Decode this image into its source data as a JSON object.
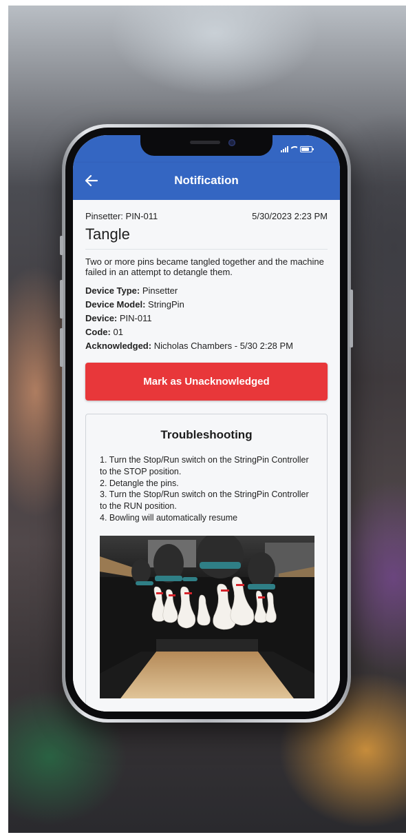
{
  "app_bar": {
    "title": "Notification",
    "back_icon": "arrow-left-icon"
  },
  "status_bar": {
    "icons": [
      "signal-icon",
      "wifi-icon",
      "battery-icon"
    ]
  },
  "notification": {
    "pinsetter": "Pinsetter: PIN-011",
    "timestamp": "5/30/2023 2:23 PM",
    "title": "Tangle",
    "description": "Two or more pins became tangled together and the machine failed in an attempt to detangle them.",
    "details": [
      {
        "label": "Device Type:",
        "value": "Pinsetter"
      },
      {
        "label": "Device Model:",
        "value": "StringPin"
      },
      {
        "label": "Device:",
        "value": "PIN-011"
      },
      {
        "label": "Code:",
        "value": "01"
      },
      {
        "label": "Acknowledged:",
        "value": "Nicholas Chambers - 5/30 2:28 PM"
      }
    ]
  },
  "actions": {
    "mark_unacknowledged": "Mark as Unacknowledged"
  },
  "troubleshooting": {
    "title": "Troubleshooting",
    "steps": [
      "1. Turn the Stop/Run switch on the StringPin Controller to the STOP position.",
      "2. Detangle the pins.",
      "3. Turn the Stop/Run switch on the StringPin Controller to the RUN position.",
      "4. Bowling will automatically resume"
    ],
    "image": "bowling-pins-tangled-photo"
  },
  "fab": {
    "icon": "wrench-icon"
  },
  "colors": {
    "primary": "#3466c2",
    "danger": "#e8373a",
    "background": "#f6f7f9"
  }
}
